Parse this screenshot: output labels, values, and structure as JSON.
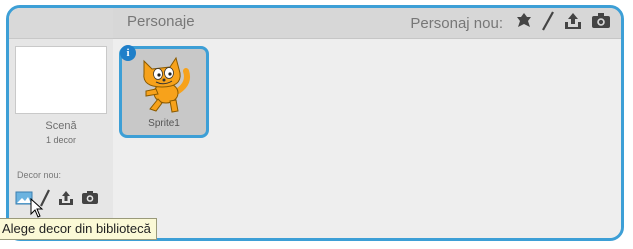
{
  "stage": {
    "title": "Scenă",
    "backdrop_count": "1 decor",
    "new_backdrop_label": "Decor nou:",
    "backdrop_icons": [
      "library-icon",
      "paint-icon",
      "upload-icon",
      "camera-icon"
    ]
  },
  "sprites": {
    "section_title": "Personaje",
    "new_sprite_label": "Personaj nou:",
    "new_sprite_icons": [
      "library-icon",
      "paint-icon",
      "upload-icon",
      "camera-icon"
    ],
    "items": [
      {
        "name": "Sprite1",
        "selected": true
      }
    ]
  },
  "tooltip": {
    "text": "Alege decor din bibliotecă"
  },
  "colors": {
    "accent": "#3d9fd6",
    "info_badge": "#1f7fc9",
    "cat_orange": "#f7a21b"
  }
}
